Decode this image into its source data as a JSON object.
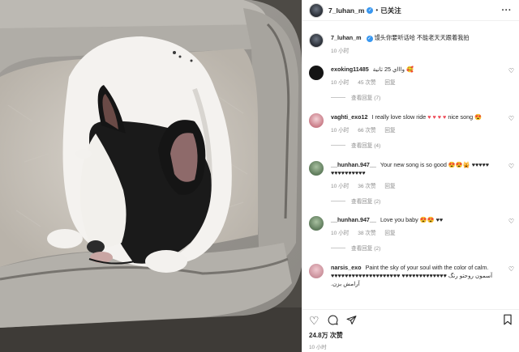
{
  "header": {
    "username": "7_luhan_m",
    "verified_glyph": "✓",
    "separator": "•",
    "follow_label": "已关注",
    "more_glyph": "···",
    "avatar_icon": "user-avatar"
  },
  "caption": {
    "username": "7_luhan_m",
    "text": "馒头你要听话哈 不能老天天跟着我拍",
    "time": "10 小时"
  },
  "comments": [
    {
      "username": "exoking11485",
      "text": "واااي 25 ثانية",
      "emoji": "🥰",
      "time": "10 小时",
      "likes": "45 次赞",
      "reply_label": "回复",
      "view_replies": "查看回复 (7)",
      "avatar_color": "#141414"
    },
    {
      "username": "vaghti_exo12",
      "text": "I really love slow ride",
      "hearts": "♥ ♥ ♥ ♥",
      "tail": "nice song",
      "emoji": "😍",
      "time": "10 小时",
      "likes": "66 次赞",
      "reply_label": "回复",
      "view_replies": "查看回复 (4)",
      "avatar_color": "#c87a86"
    },
    {
      "username": "__hunhan.947__",
      "text": "Your new song is so good",
      "emoji": "😍😍🙀",
      "hearts_black": "♥♥♥♥♥",
      "hearts_black_2": "♥♥♥♥♥♥♥♥♥♥",
      "time": "10 小时",
      "likes": "36 次赞",
      "reply_label": "回复",
      "view_replies": "查看回复 (2)",
      "avatar_color": "#5d7a5a"
    },
    {
      "username": "__hunhan.947__",
      "text": "Love you baby",
      "emoji": "😍😍",
      "hearts_black": "♥♥",
      "time": "10 小时",
      "likes": "38 次赞",
      "reply_label": "回复",
      "view_replies": "查看回复 (2)",
      "avatar_color": "#5d7a5a"
    },
    {
      "username": "narsis_exo",
      "text": "Paint the sky of your soul with the color of calm.",
      "hearts_black": "♥♥♥♥♥♥♥♥♥♥♥♥♥♥♥♥♥♥♥♥",
      "hearts_black_2": "♥♥♥♥♥♥♥♥♥♥♥♥♥",
      "text_2": "آسمون روحتو رنگ آرامش بزن.",
      "avatar_color": "#c98f9a"
    }
  ],
  "actions": {
    "like_icon": "heart-outline",
    "comment_icon": "speech-bubble",
    "share_icon": "paper-plane",
    "save_icon": "bookmark"
  },
  "likes": "24.8万 次赞",
  "post_time": "10 小时",
  "colors": {
    "accent": "#3897f0",
    "heart": "#ed4956",
    "muted": "#8e8e8e"
  }
}
